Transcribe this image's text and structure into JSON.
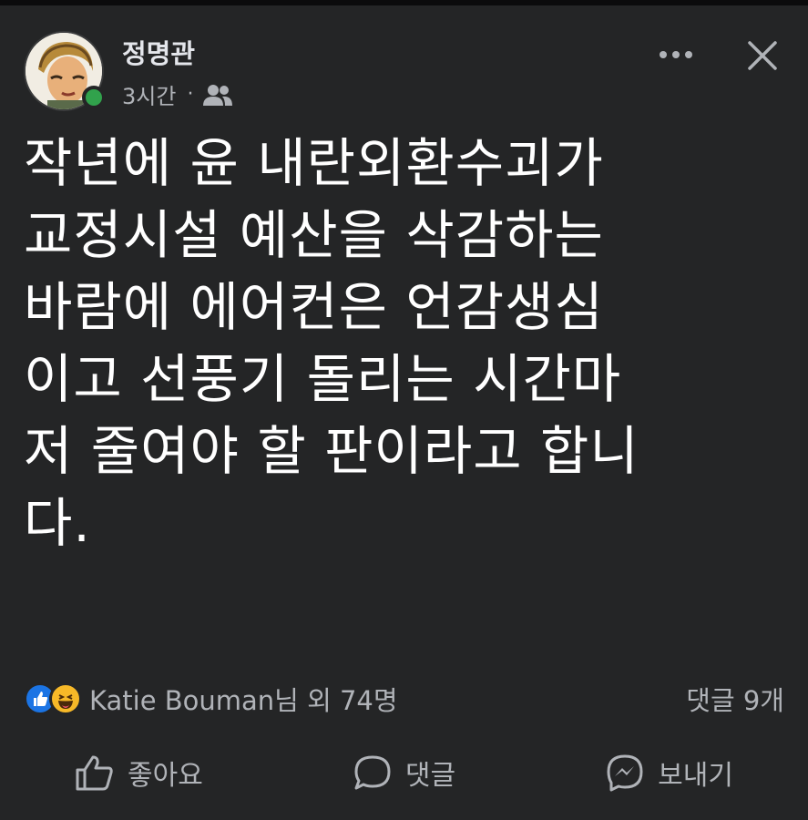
{
  "post": {
    "author_name": "정명관",
    "time": "3시간",
    "separator": "·",
    "audience_icon": "friends-icon",
    "text": "작년에 윤 내란외환수괴가\n교정시설 예산을 삭감하는\n바람에 에어컨은 언감생심\n이고 선풍기 돌리는 시간마\n저 줄여야 할 판이라고 합니\n다."
  },
  "header_icons": {
    "more": "more-dots-icon",
    "close": "close-icon"
  },
  "reactions": {
    "icons": [
      "like-reaction-icon",
      "haha-reaction-icon"
    ],
    "summary": "Katie Bouman님 외 74명",
    "comment_count": "댓글 9개"
  },
  "actions": {
    "like_label": "좋아요",
    "comment_label": "댓글",
    "send_label": "보내기"
  },
  "colors": {
    "background": "#242526",
    "text": "#ffffff",
    "muted": "#b0b3b8",
    "online": "#31a24c",
    "like_blue": "#1b74e4",
    "haha_yellow": "#f7b928"
  }
}
